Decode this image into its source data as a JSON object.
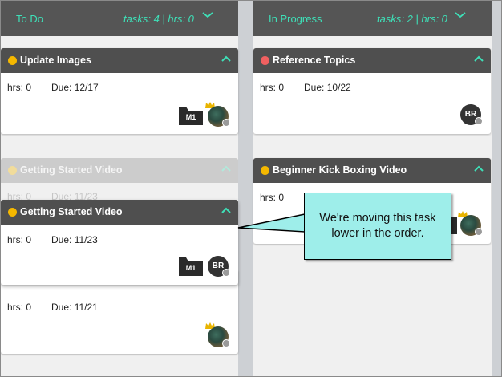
{
  "columns": [
    {
      "title": "To Do",
      "stats": "tasks: 4 | hrs: 0"
    },
    {
      "title": "In Progress",
      "stats": "tasks: 2 | hrs: 0"
    }
  ],
  "colors": {
    "accent": "#3ee0b8",
    "header_bg": "#555555",
    "card_header_bg": "#4f4f4f",
    "priority_yellow": "#f5b800",
    "priority_red": "#f06060",
    "callout_bg": "#9eeeea"
  },
  "cards": {
    "update_images": {
      "title": "Update Images",
      "hrs": "hrs: 0",
      "due": "Due: 12/17",
      "folder": "M1",
      "priority_color": "#f5b800"
    },
    "reference_topics": {
      "title": "Reference Topics",
      "hrs": "hrs: 0",
      "due": "Due: 10/22",
      "avatar": "BR",
      "priority_color": "#f06060"
    },
    "ghost_getting_started": {
      "title": "Getting Started Video",
      "hrs": "hrs: 0",
      "due": "Due: 11/23"
    },
    "getting_started": {
      "title": "Getting Started Video",
      "hrs": "hrs: 0",
      "due": "Due: 11/23",
      "folder": "M1",
      "avatar": "BR",
      "priority_color": "#f5b800"
    },
    "beginner_kick_boxing": {
      "title": "Beginner Kick Boxing Video",
      "hrs": "hrs: 0",
      "priority_color": "#f5b800"
    },
    "lower_card": {
      "hrs": "hrs: 0",
      "due": "Due: 11/21"
    }
  },
  "callout": {
    "text": "We're moving this task lower in the order."
  },
  "icons": {
    "collapse": "chevron-down-icon",
    "card_toggle": "chevron-up-icon",
    "folder": "folder-icon",
    "crown": "crown-icon"
  }
}
